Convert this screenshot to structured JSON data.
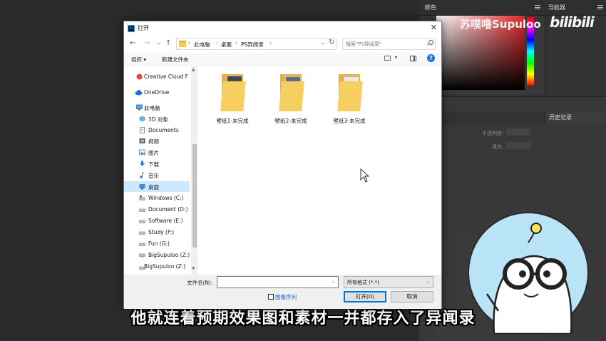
{
  "app": {
    "panels": {
      "color_tab": "颜色",
      "navigator_tab": "导航器",
      "history_tab": "历史记录",
      "opacity_label": "不透明度:",
      "fill_label": "填充:"
    }
  },
  "watermark": {
    "uploader": "苏噗噜Supuloo",
    "logo": "bilibili"
  },
  "subtitle": "他就连着预期效果图和素材一并都存入了异闻录",
  "dialog": {
    "title": "打开",
    "ps_badge": "Ps",
    "close_glyph": "✕",
    "address": {
      "crumbs": [
        "此电脑",
        "桌面",
        "PS异闻录"
      ],
      "search_placeholder": "搜索\"PS异闻录\""
    },
    "toolbar": {
      "organize": "组织 ▾",
      "new_folder": "新建文件夹",
      "help": "?"
    },
    "sidebar": [
      {
        "label": "Creative Cloud F",
        "icon": "creative-cloud-icon"
      },
      {
        "label": "OneDrive",
        "icon": "cloud-icon"
      },
      {
        "label": "此电脑",
        "icon": "computer-icon"
      },
      {
        "label": "3D 对象",
        "icon": "cube-icon"
      },
      {
        "label": "Documents",
        "icon": "document-icon"
      },
      {
        "label": "视频",
        "icon": "video-icon"
      },
      {
        "label": "图片",
        "icon": "picture-icon"
      },
      {
        "label": "下载",
        "icon": "download-icon"
      },
      {
        "label": "音乐",
        "icon": "music-icon"
      },
      {
        "label": "桌面",
        "icon": "desktop-icon",
        "selected": true
      },
      {
        "label": "Windows (C:)",
        "icon": "drive-icon"
      },
      {
        "label": "Document (D:)",
        "icon": "drive-icon"
      },
      {
        "label": "Software (E:)",
        "icon": "drive-icon"
      },
      {
        "label": "Study (F:)",
        "icon": "drive-icon"
      },
      {
        "label": "Fun (G:)",
        "icon": "drive-icon"
      },
      {
        "label": "BigSupuloo (Z:)",
        "icon": "network-drive-icon"
      },
      {
        "label": "BigSupuloo (Z:)",
        "icon": "network-drive-icon"
      }
    ],
    "files": [
      {
        "name": "壁纸1-未完成"
      },
      {
        "name": "壁纸2-未完成"
      },
      {
        "name": "壁纸3-未完成"
      }
    ],
    "footer": {
      "filename_label": "文件名(N):",
      "filename_value": "",
      "filetype": "所有格式 (*.*)",
      "image_sequence": "图像序列",
      "open": "打开(O)",
      "cancel": "取消"
    }
  },
  "colors": {
    "ps_dark": "#2b2b2b",
    "selection": "#cce8ff",
    "folder": "#f6cf60",
    "accent": "#0078d7"
  }
}
